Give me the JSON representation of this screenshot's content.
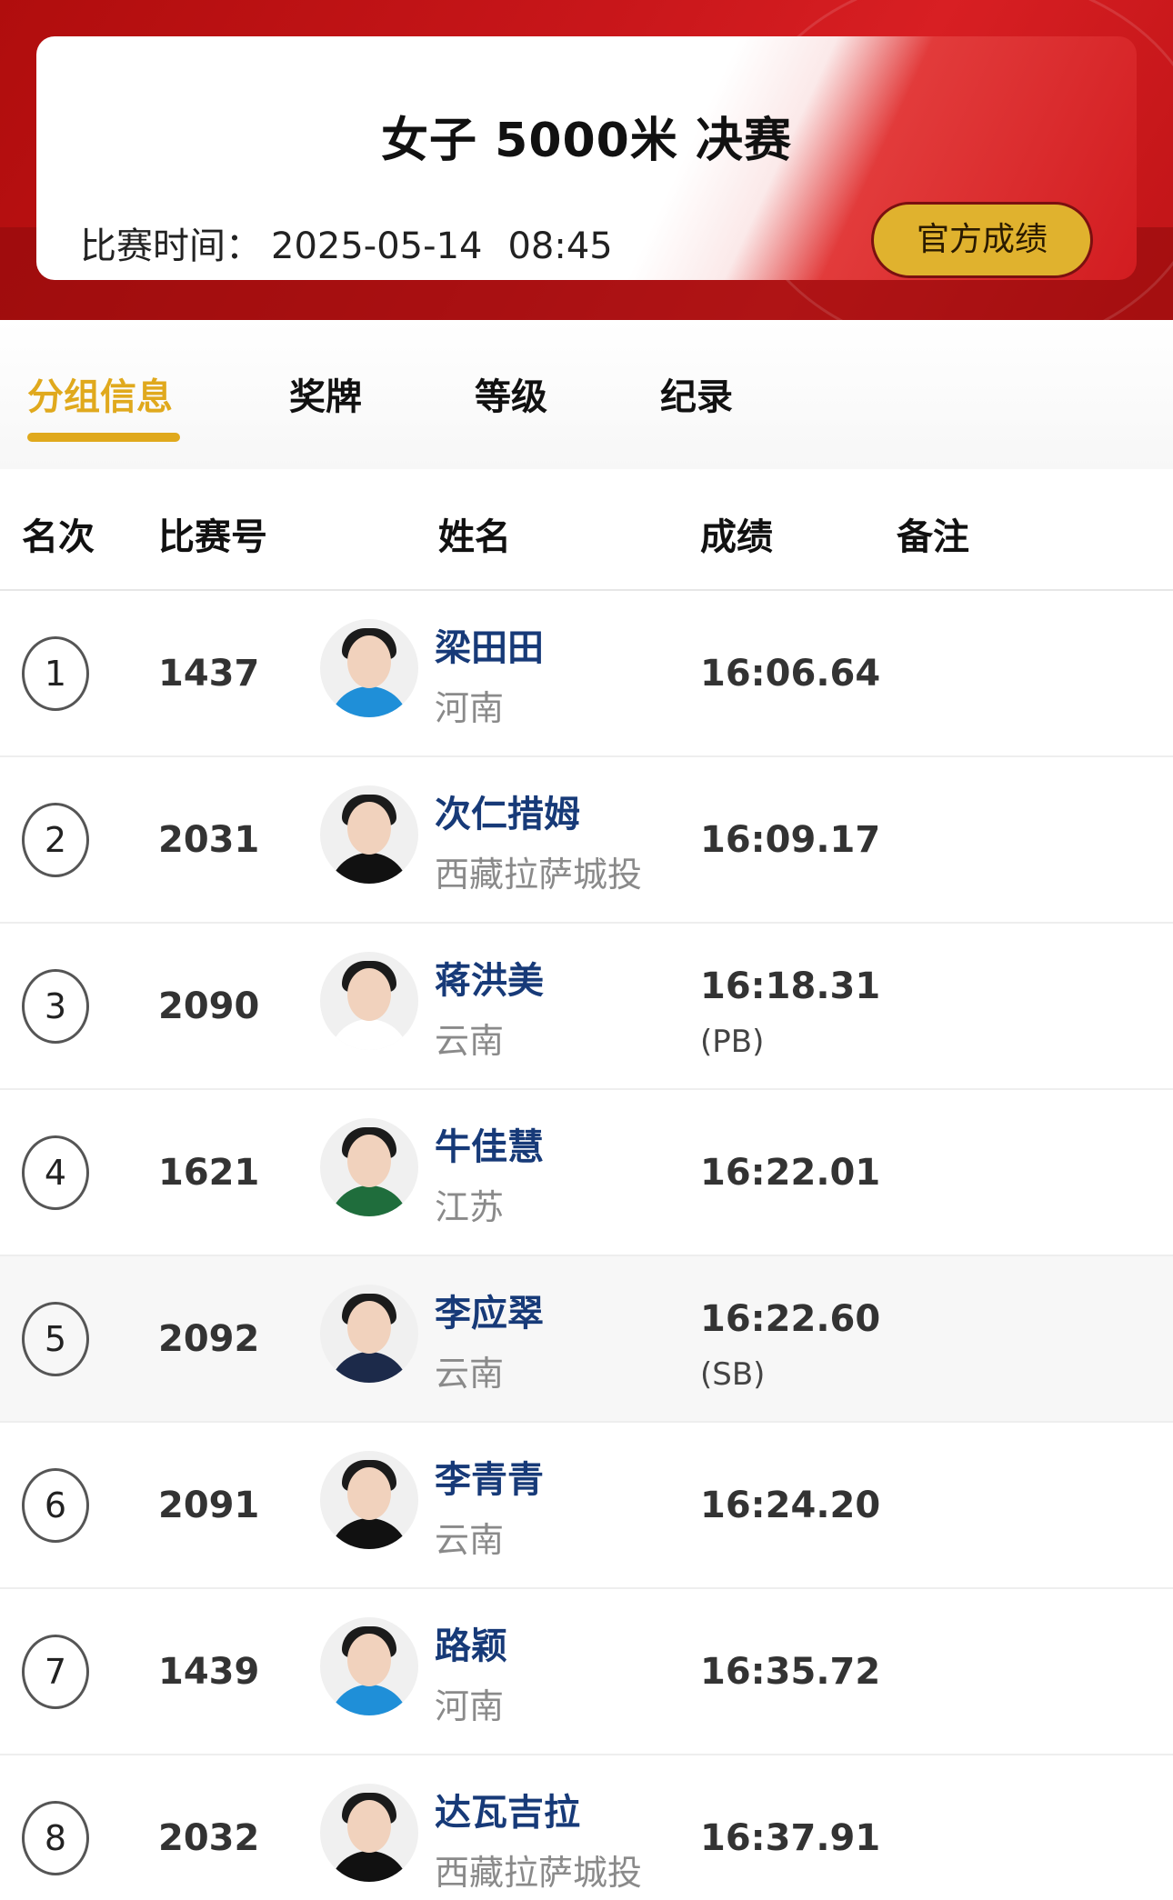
{
  "header": {
    "title": "女子 5000米 决赛",
    "time_label": "比赛时间：",
    "date": "2025-05-14",
    "clock": "08:45",
    "official_button": "官方成绩"
  },
  "tabs": [
    {
      "label": "分组信息",
      "active": true
    },
    {
      "label": "奖牌",
      "active": false
    },
    {
      "label": "等级",
      "active": false
    },
    {
      "label": "纪录",
      "active": false
    }
  ],
  "columns": [
    "名次",
    "比赛号",
    "姓名",
    "成绩",
    "备注"
  ],
  "rows": [
    {
      "rank": "1",
      "bib": "1437",
      "name": "梁田田",
      "team": "河南",
      "result": "16:06.64",
      "note": "",
      "jersey": "#1f8fd8"
    },
    {
      "rank": "2",
      "bib": "2031",
      "name": "次仁措姆",
      "team": "西藏拉萨城投",
      "result": "16:09.17",
      "note": "",
      "jersey": "#111111"
    },
    {
      "rank": "3",
      "bib": "2090",
      "name": "蒋洪美",
      "team": "云南",
      "result": "16:18.31",
      "note": "(PB)",
      "jersey": "#ffffff"
    },
    {
      "rank": "4",
      "bib": "1621",
      "name": "牛佳慧",
      "team": "江苏",
      "result": "16:22.01",
      "note": "",
      "jersey": "#1f6d3c"
    },
    {
      "rank": "5",
      "bib": "2092",
      "name": "李应翠",
      "team": "云南",
      "result": "16:22.60",
      "note": "(SB)",
      "jersey": "#1c2a4a"
    },
    {
      "rank": "6",
      "bib": "2091",
      "name": "李青青",
      "team": "云南",
      "result": "16:24.20",
      "note": "",
      "jersey": "#111111"
    },
    {
      "rank": "7",
      "bib": "1439",
      "name": "路颖",
      "team": "河南",
      "result": "16:35.72",
      "note": "",
      "jersey": "#1f8fd8"
    },
    {
      "rank": "8",
      "bib": "2032",
      "name": "达瓦吉拉",
      "team": "西藏拉萨城投",
      "result": "16:37.91",
      "note": "",
      "jersey": "#111111"
    }
  ]
}
